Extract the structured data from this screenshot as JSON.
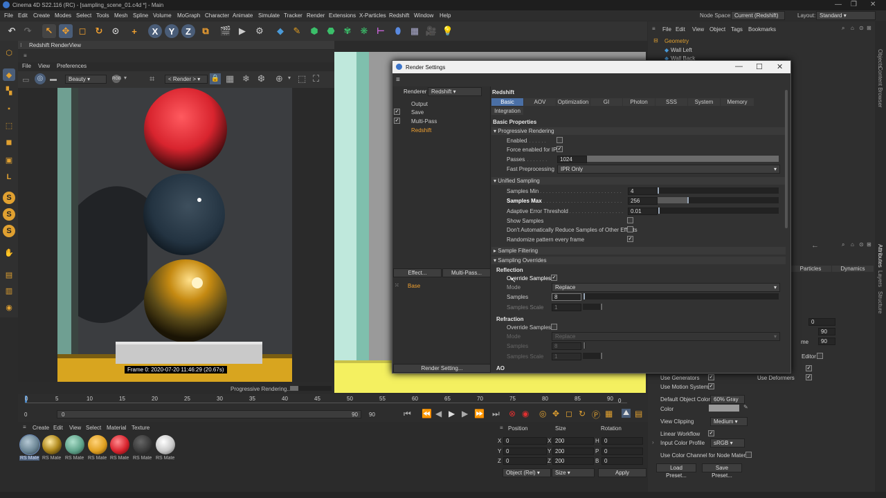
{
  "window": {
    "title": "Cinema 4D S22.116 (RC) - [sampling_scene_01.c4d *] - Main",
    "node_space_label": "Node Space:",
    "node_space_value": "Current (Redshift)",
    "layout_label": "Layout:",
    "layout_value": "Standard"
  },
  "menu": [
    "File",
    "Edit",
    "Create",
    "Modes",
    "Select",
    "Tools",
    "Mesh",
    "Spline",
    "Volume",
    "MoGraph",
    "Character",
    "Animate",
    "Simulate",
    "Tracker",
    "Render",
    "Extensions",
    "X-Particles",
    "Redshift",
    "Window",
    "Help"
  ],
  "render_view": {
    "tab_title": "Redshift RenderView",
    "menu": [
      "File",
      "View",
      "Preferences"
    ],
    "aov_value": "Beauty",
    "render_dropdown": "< Render >",
    "frame_info": "Frame  0:  2020-07-20  11:46:29  (20.67s)",
    "status": "Progressive Rendering...",
    "progress_fraction": 0.2
  },
  "dialog": {
    "title": "Render Settings",
    "renderer_label": "Renderer",
    "renderer_value": "Redshift",
    "tree": [
      "Output",
      "Save",
      "Multi-Pass",
      "Redshift"
    ],
    "tree_checked": [
      false,
      true,
      true,
      false
    ],
    "effect_button": "Effect...",
    "multipass_button": "Multi-Pass...",
    "base_label": "Base",
    "render_setting_button": "Render Setting...",
    "heading": "Redshift",
    "tabs": [
      "Basic",
      "AOV",
      "Optimization",
      "GI",
      "Photon",
      "SSS",
      "System",
      "Memory",
      "Integration"
    ],
    "basic_properties": "Basic Properties",
    "progressive": {
      "header": "Progressive Rendering",
      "enabled_label": "Enabled",
      "force_ipr_label": "Force enabled for IPR",
      "passes_label": "Passes",
      "passes_value": "1024",
      "fast_pre_label": "Fast Preprocessing",
      "fast_pre_value": "IPR Only"
    },
    "unified": {
      "header": "Unified Sampling",
      "min_label": "Samples Min",
      "min_value": "4",
      "max_label": "Samples Max",
      "max_value": "256",
      "adaptive_label": "Adaptive Error Threshold",
      "adaptive_value": "0.01",
      "show_label": "Show Samples",
      "dont_reduce_label": "Don't Automatically Reduce Samples of Other Effects",
      "randomize_label": "Randomize pattern every frame"
    },
    "sample_filtering": "Sample Filtering",
    "sampling_overrides": "Sampling Overrides",
    "reflection": {
      "header": "Reflection",
      "override_label": "Override Samples",
      "mode_label": "Mode",
      "mode_value": "Replace",
      "samples_label": "Samples",
      "samples_value": "8",
      "scale_label": "Samples Scale",
      "scale_value": "1"
    },
    "refraction": {
      "header": "Refraction",
      "override_label": "Override Samples",
      "mode_label": "Mode",
      "mode_value": "Replace",
      "samples_label": "Samples",
      "samples_value": "8",
      "scale_label": "Samples Scale",
      "scale_value": "1"
    },
    "ao_label": "AO"
  },
  "timeline": {
    "ticks": [
      "0",
      "5",
      "10",
      "15",
      "20",
      "25",
      "30",
      "35",
      "40",
      "45",
      "50",
      "55",
      "60",
      "65",
      "70",
      "75",
      "80",
      "85",
      "90"
    ],
    "current_frame": "0",
    "start": "0",
    "range_start": "0",
    "range_end": "90",
    "end": "90",
    "frame_box": "0"
  },
  "materials": {
    "menu": [
      "Create",
      "Edit",
      "View",
      "Select",
      "Material",
      "Texture"
    ],
    "items": [
      {
        "label": "RS Mate",
        "color": "#6d8796"
      },
      {
        "label": "RS Mate",
        "color": "#b08a1f"
      },
      {
        "label": "RS Mate",
        "color": "#5fa38a"
      },
      {
        "label": "RS Mate",
        "color": "#e0a021"
      },
      {
        "label": "RS Mate",
        "color": "#d8242e"
      },
      {
        "label": "RS Mate",
        "color": "#3a3a3a"
      },
      {
        "label": "RS Mate",
        "color": "#c9c9c9"
      }
    ]
  },
  "coords": {
    "headers": [
      "Position",
      "Size",
      "Rotation"
    ],
    "rows": [
      {
        "axis": "X",
        "pos": "0",
        "size_axis": "X",
        "size": "200",
        "rot_axis": "H",
        "rot": "0"
      },
      {
        "axis": "Y",
        "pos": "0",
        "size_axis": "Y",
        "size": "200",
        "rot_axis": "P",
        "rot": "0"
      },
      {
        "axis": "Z",
        "pos": "0",
        "size_axis": "Z",
        "size": "200",
        "rot_axis": "B",
        "rot": "0"
      }
    ],
    "object_dd": "Object (Rel)",
    "size_dd": "Size",
    "apply": "Apply"
  },
  "object_manager": {
    "menu": [
      "File",
      "Edit",
      "View",
      "Object",
      "Tags",
      "Bookmarks"
    ],
    "objects": [
      "Geometry",
      "Wall Left",
      "Wall Back"
    ]
  },
  "attributes": {
    "tabs": [
      "Particles",
      "Dynamics"
    ],
    "values": {
      "v1": "0",
      "v2": "90",
      "me_label": "me",
      "v3": "90",
      "editor_label": "Editor"
    },
    "use_generators": "Use Generators",
    "use_deformers": "Use Deformers",
    "use_motion": "Use Motion System",
    "default_color_label": "Default Object Color",
    "default_color_value": "60% Gray",
    "color_label": "Color",
    "view_clipping_label": "View Clipping",
    "view_clipping_value": "Medium",
    "linear_workflow": "Linear Workflow",
    "input_color_label": "Input Color Profile",
    "input_color_value": "sRGB",
    "use_color_channel": "Use Color Channel for Node Material",
    "load_preset": "Load Preset...",
    "save_preset": "Save Preset..."
  },
  "side_tabs": [
    "Objects",
    "Content Browser",
    "Attributes",
    "Layers",
    "Structure"
  ]
}
